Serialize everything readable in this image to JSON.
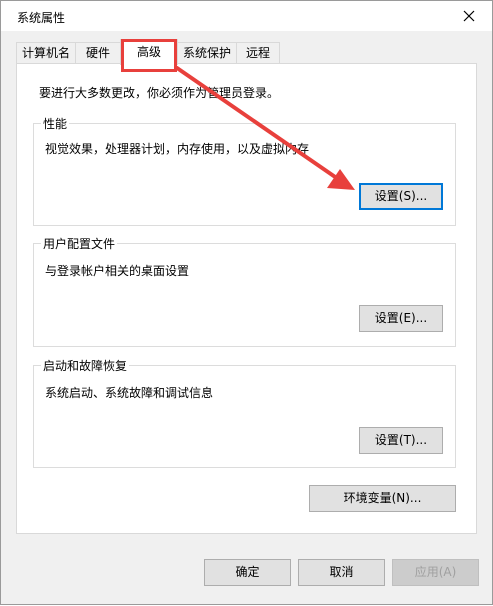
{
  "window": {
    "title": "系统属性"
  },
  "tabs": [
    {
      "label": "计算机名",
      "active": false
    },
    {
      "label": "硬件",
      "active": false
    },
    {
      "label": "高级",
      "active": true
    },
    {
      "label": "系统保护",
      "active": false
    },
    {
      "label": "远程",
      "active": false
    }
  ],
  "advanced": {
    "admin_note": "要进行大多数更改，你必须作为管理员登录。",
    "performance": {
      "title": "性能",
      "description": "视觉效果，处理器计划，内存使用，以及虚拟内存",
      "button": "设置(S)..."
    },
    "user_profiles": {
      "title": "用户配置文件",
      "description": "与登录帐户相关的桌面设置",
      "button": "设置(E)..."
    },
    "startup_recovery": {
      "title": "启动和故障恢复",
      "description": "系统启动、系统故障和调试信息",
      "button": "设置(T)..."
    },
    "env_button": "环境变量(N)..."
  },
  "footer": {
    "ok": "确定",
    "cancel": "取消",
    "apply": "应用(A)"
  },
  "colors": {
    "annotation": "#e8403c",
    "focus": "#0078d7"
  },
  "icons": {
    "close": "close-icon"
  }
}
